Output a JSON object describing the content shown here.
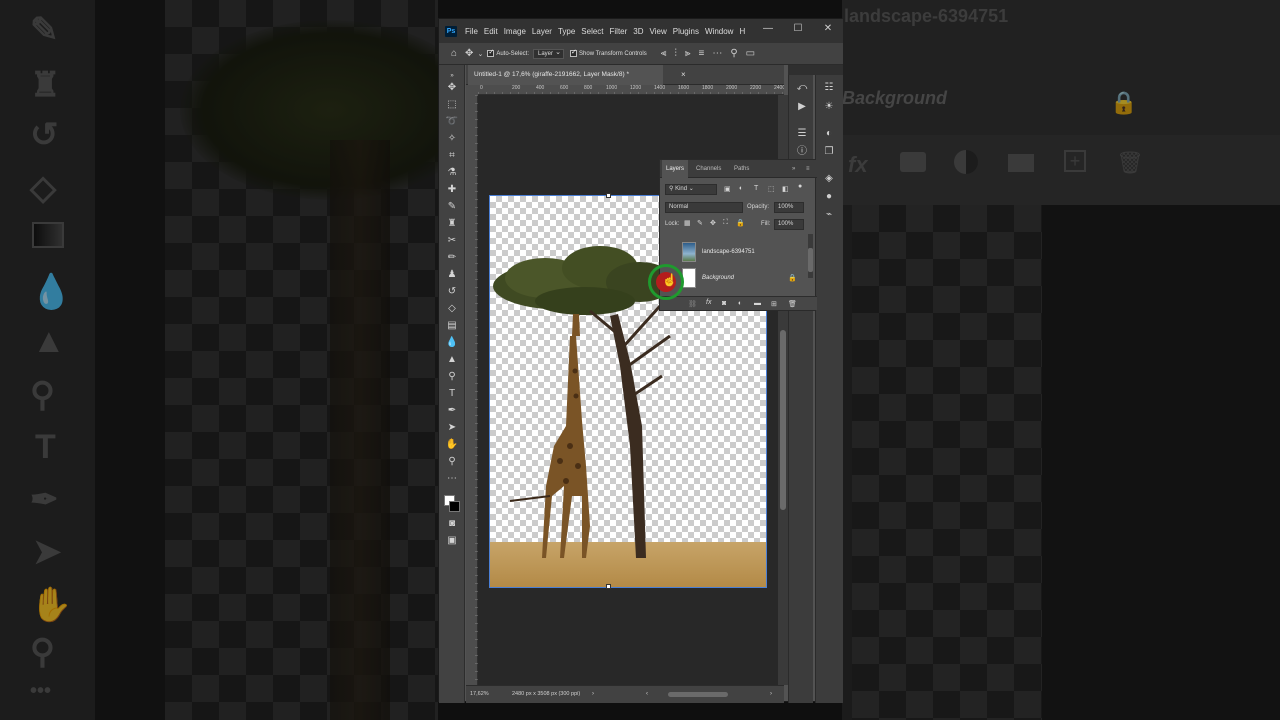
{
  "app": {
    "menu": [
      "File",
      "Edit",
      "Image",
      "Layer",
      "Type",
      "Select",
      "Filter",
      "3D",
      "View",
      "Plugins",
      "Window",
      "H"
    ],
    "logo": "Ps"
  },
  "options": {
    "auto_select_label": "Auto-Select:",
    "auto_select_value": "Layer",
    "transform_label": "Show Transform Controls"
  },
  "document": {
    "tab_title": "Untitled-1 @ 17,6% (giraffe-2191662, Layer Mask/8) *",
    "zoom": "17,62%",
    "info": "2480 px x 3508 px (300 ppi)",
    "ruler_ticks": [
      "0",
      "200",
      "400",
      "600",
      "800",
      "1000",
      "1200",
      "1400",
      "1600",
      "1800",
      "2000",
      "2200",
      "2400"
    ]
  },
  "layers_panel": {
    "tabs": [
      "Layers",
      "Channels",
      "Paths"
    ],
    "kind_label": "Kind",
    "blend_mode": "Normal",
    "opacity_label": "Opacity:",
    "opacity_value": "100%",
    "lock_label": "Lock:",
    "fill_label": "Fill:",
    "fill_value": "100%",
    "layers": [
      {
        "name": "landscape-6394751"
      },
      {
        "name": "Background"
      }
    ]
  },
  "background": {
    "layer_title": "landscape-6394751",
    "layer_bg": "Background",
    "fx_label": "fx"
  },
  "colors": {
    "accent": "#31a8ff",
    "cursor_ring": "#1f9a2e",
    "cursor_fill": "#b51d1d"
  }
}
